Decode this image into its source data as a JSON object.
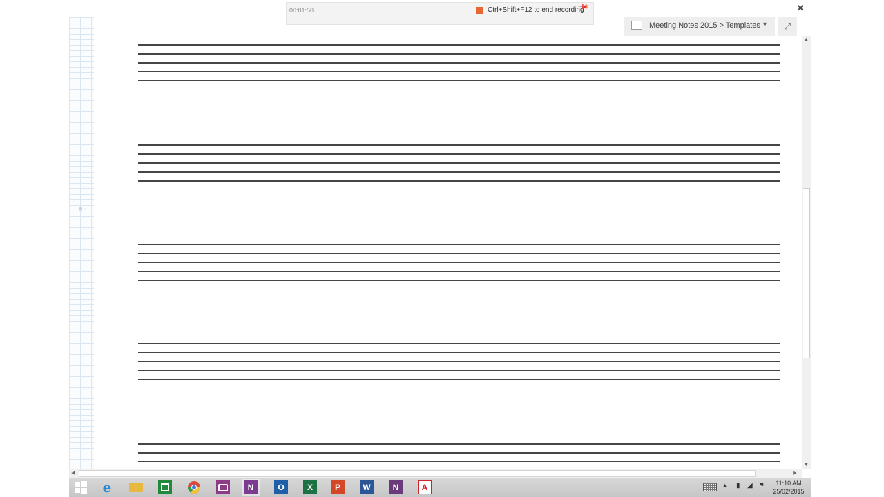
{
  "recording": {
    "elapsed": "00:01:50",
    "hint": "Ctrl+Shift+F12 to end recording"
  },
  "breadcrumb": {
    "text": "Meeting Notes 2015 > Templates",
    "dropdown_glyph": "▼"
  },
  "controls": {
    "close_glyph": "✕",
    "expand_glyph": "⤢",
    "pin_glyph": "📌"
  },
  "taskbar": {
    "icons": [
      {
        "name": "windows-start-icon",
        "glyph": "",
        "color": "#3c7fd3"
      },
      {
        "name": "internet-explorer-icon",
        "glyph": "e",
        "color": "#2a8ad4"
      },
      {
        "name": "file-explorer-icon",
        "glyph": "",
        "color": "#e7b93e"
      },
      {
        "name": "store-icon",
        "glyph": "",
        "color": "#1f8a3a"
      },
      {
        "name": "chrome-icon",
        "glyph": "",
        "color": "#d94c3d"
      },
      {
        "name": "camera-icon",
        "glyph": "",
        "color": "#8f3a86"
      },
      {
        "name": "onenote-icon",
        "glyph": "N",
        "color": "#7b3b8f"
      },
      {
        "name": "outlook-icon",
        "glyph": "O",
        "color": "#1e5fa8"
      },
      {
        "name": "excel-icon",
        "glyph": "X",
        "color": "#1e7145"
      },
      {
        "name": "powerpoint-icon",
        "glyph": "P",
        "color": "#d24726"
      },
      {
        "name": "word-icon",
        "glyph": "W",
        "color": "#2b5797"
      },
      {
        "name": "onenote-clipper-icon",
        "glyph": "N",
        "color": "#6a3a7a"
      },
      {
        "name": "acrobat-icon",
        "glyph": "A",
        "color": "#d3232a"
      }
    ],
    "clock_time": "11:10 AM",
    "clock_date": "25/02/2015"
  },
  "colors": {
    "staff_line": "#454545",
    "record_indicator": "#e8662f"
  }
}
